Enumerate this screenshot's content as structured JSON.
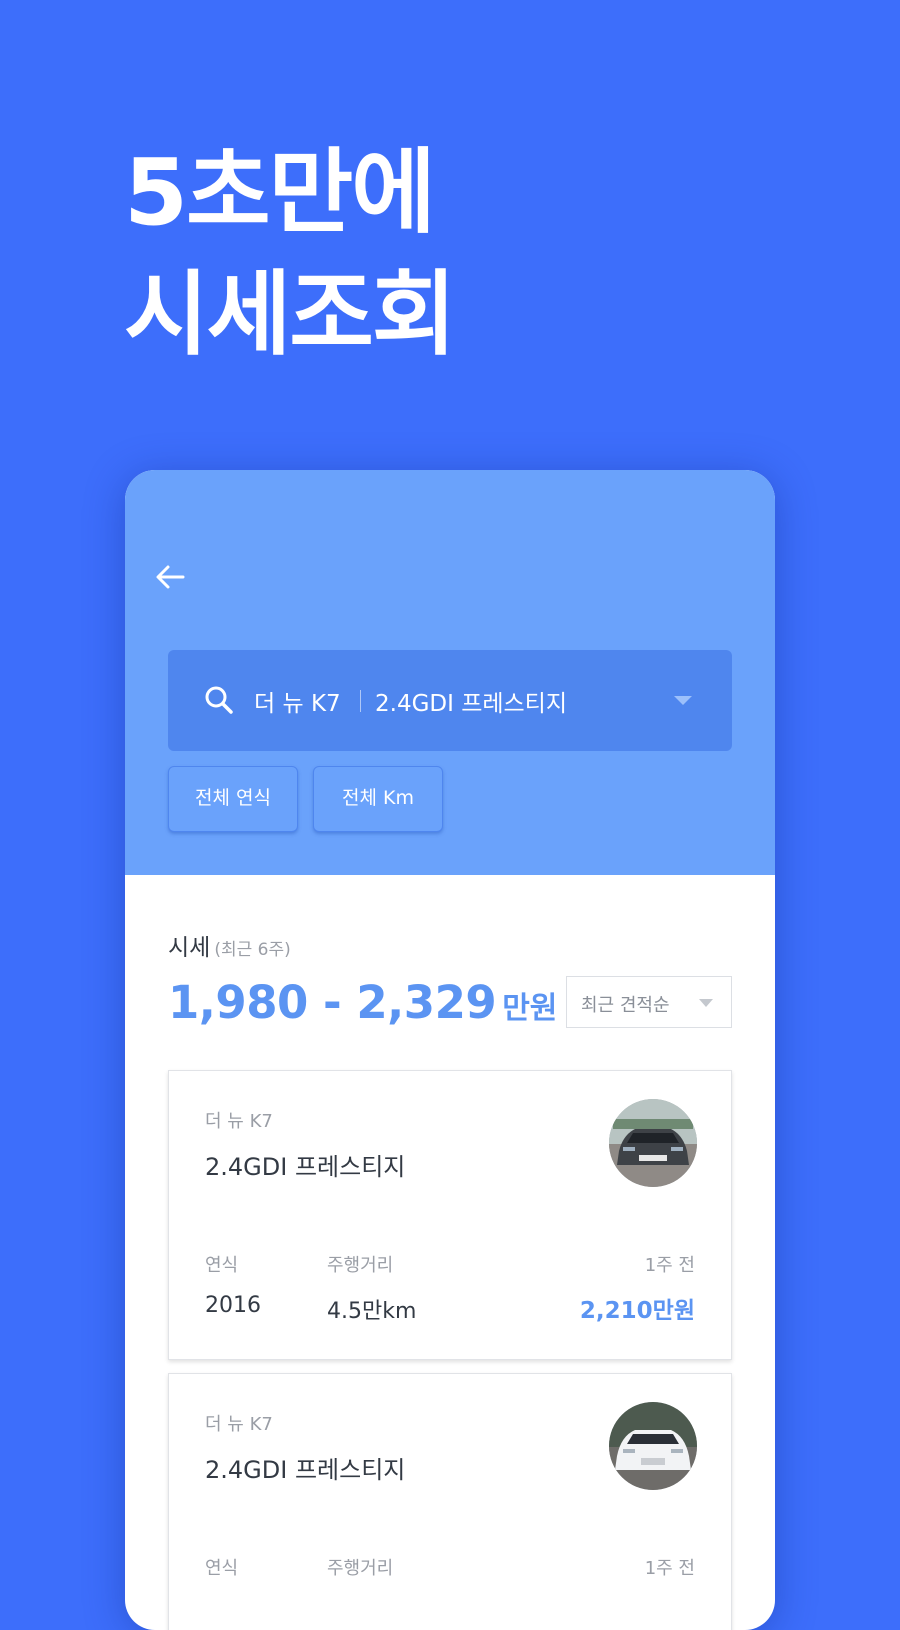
{
  "headline": {
    "line1": "5초만에",
    "line2": "시세조회"
  },
  "search": {
    "model": "더 뉴 K7",
    "trim": "2.4GDI 프레스티지"
  },
  "filters": {
    "year": "전체 연식",
    "km": "전체 Km"
  },
  "price": {
    "title": "시세",
    "subtitle": "(최근 6주)",
    "range": "1,980 - 2,329",
    "unit": "만원"
  },
  "sort": {
    "selected": "최근 견적순"
  },
  "listings": [
    {
      "model": "더 뉴 K7",
      "trim": "2.4GDI 프레스티지",
      "year_label": "연식",
      "mileage_label": "주행거리",
      "date": "1주 전",
      "year": "2016",
      "mileage": "4.5만km",
      "price": "2,210만원",
      "car_color": "#3e4247"
    },
    {
      "model": "더 뉴 K7",
      "trim": "2.4GDI 프레스티지",
      "year_label": "연식",
      "mileage_label": "주행거리",
      "date": "1주 전",
      "year": "",
      "mileage": "",
      "price": "",
      "car_color": "#f2f3f5"
    }
  ],
  "colors": {
    "background": "#3d6efb",
    "header": "#6aa2fb",
    "search_bar": "#4f86ee",
    "accent": "#5b94f2"
  }
}
